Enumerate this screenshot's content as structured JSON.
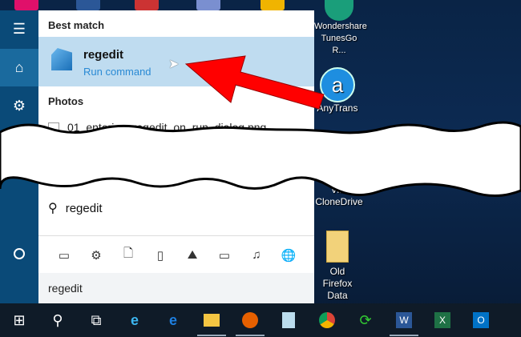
{
  "start_menu": {
    "best_match_label": "Best match",
    "result": {
      "title": "regedit",
      "subtitle": "Run command"
    },
    "photos_label": "Photos",
    "photo_item": "01_entering_regedit_on_run_dialog.png",
    "search_query": "regedit",
    "bottom_query": "regedit",
    "filter_icons": [
      "apps-icon",
      "settings-icon",
      "document-icon",
      "folder-icon",
      "photo-icon",
      "video-icon",
      "music-icon",
      "web-icon"
    ]
  },
  "desktop": {
    "icons": [
      {
        "label": "Wondershare TunesGo R..."
      },
      {
        "label": "AnyTrans"
      },
      {
        "label": "Vi... CloneDrive"
      },
      {
        "label": "Old Firefox Data"
      }
    ]
  },
  "taskbar": {
    "items": [
      "start",
      "search",
      "task-view",
      "internet-explorer",
      "edge",
      "file-explorer",
      "firefox",
      "notepad",
      "chrome",
      "sync",
      "word",
      "excel",
      "outlook"
    ]
  },
  "colors": {
    "sidebar": "#0a4a78",
    "selection": "#bfdcf0",
    "accent": "#2a8ad4",
    "arrow": "#ff0000"
  }
}
